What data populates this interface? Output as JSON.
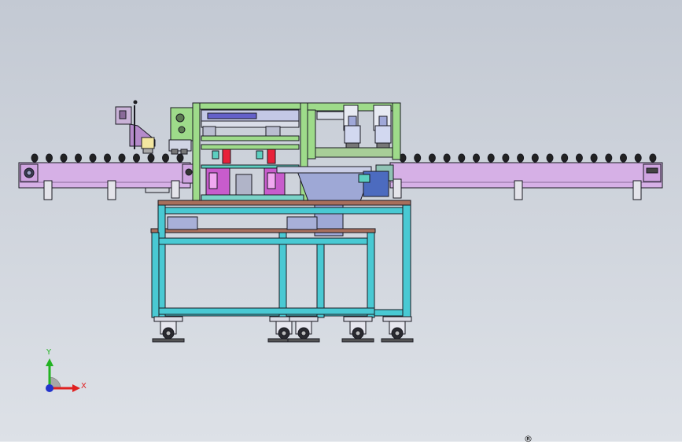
{
  "view": {
    "background_top": "#c3c9d3",
    "background_bottom": "#dde1e7"
  },
  "colors": {
    "conveyor": "#d6b0e6",
    "frame_cyan": "#49c9d3",
    "frame_green": "#9edb8a",
    "table_top": "#a86f5c",
    "bowl_feeder": "#9ea8d6",
    "accent_red": "#e8203a",
    "accent_magenta": "#c85ccc",
    "outline": "#1a1a22"
  },
  "icons": {
    "triad": "coordinate-triad-icon",
    "mark": "registered-mark-icon"
  },
  "triad": {
    "y_label": "Y",
    "x_label": "X",
    "y_color": "#22b322",
    "x_color": "#e02020",
    "z_color": "#2233cc"
  },
  "mark": {
    "symbol": "®"
  }
}
